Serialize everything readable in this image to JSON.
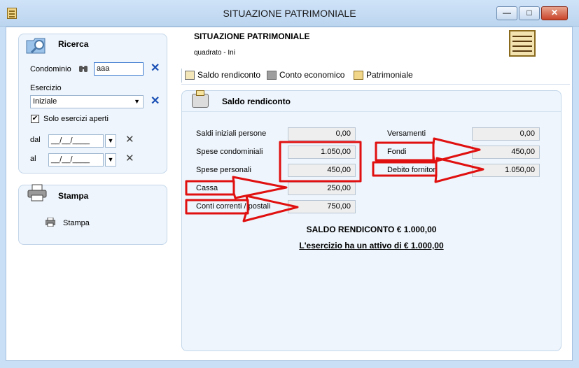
{
  "window": {
    "title": "SITUAZIONE PATRIMONIALE",
    "minimize_glyph": "—",
    "maximize_glyph": "□",
    "close_glyph": "✕"
  },
  "ricerca": {
    "title": "Ricerca",
    "condominio_label": "Condominio",
    "condominio_value": "aaa",
    "esercizio_label": "Esercizio",
    "esercizio_value": "Iniziale",
    "solo_aperti_label": "Solo esercizi aperti",
    "solo_aperti_checked": true,
    "dal_label": "dal",
    "al_label": "al",
    "date_placeholder": "__/__/____"
  },
  "stampa": {
    "title": "Stampa",
    "item_label": "Stampa"
  },
  "header": {
    "title": "SITUAZIONE PATRIMONIALE",
    "subtitle": "quadrato - Ini"
  },
  "toolbar": {
    "tabs": [
      {
        "label": "Saldo rendiconto",
        "icon": "ledger-icon"
      },
      {
        "label": "Conto economico",
        "icon": "book-icon"
      },
      {
        "label": "Patrimoniale",
        "icon": "abacus-icon"
      }
    ]
  },
  "saldo": {
    "title": "Saldo rendiconto",
    "left_rows": [
      {
        "label": "Saldi iniziali persone",
        "value": "0,00"
      },
      {
        "label": "Spese condominiali",
        "value": "1.050,00"
      },
      {
        "label": "Spese personali",
        "value": "450,00"
      },
      {
        "label": "Cassa",
        "value": "250,00"
      },
      {
        "label": "Conti correnti / postali",
        "value": "750,00"
      }
    ],
    "right_rows": [
      {
        "label": "Versamenti",
        "value": "0,00"
      },
      {
        "label": "Fondi",
        "value": "450,00"
      },
      {
        "label": "Debito fornitori",
        "value": "1.050,00"
      }
    ],
    "total": "SALDO RENDICONTO € 1.000,00",
    "note": "L'esercizio ha un attivo di € 1.000,00"
  },
  "colors": {
    "annotation_red": "#e01010",
    "accent_blue": "#1a4fb5"
  }
}
